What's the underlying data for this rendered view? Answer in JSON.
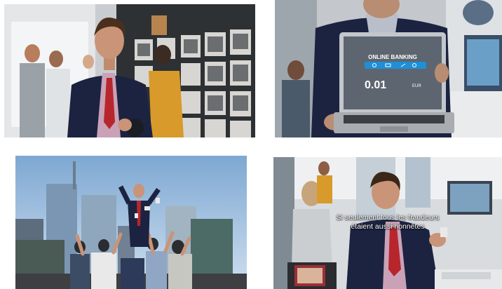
{
  "frames": [
    {
      "label": "office-scene"
    },
    {
      "label": "laptop-scene",
      "laptop": {
        "title": "ONLINE BANKING",
        "amount": "0.01",
        "currency": "EUR"
      }
    },
    {
      "label": "rooftop-scene"
    },
    {
      "label": "subtitle-scene",
      "subtitle": {
        "line1": "Si seulement tous les fraudeurs",
        "line2": "étaient aussi honnêtes"
      }
    }
  ],
  "colors": {
    "accent_blue": "#1f8fd6",
    "suit_navy": "#1c2340",
    "tie_red": "#b8262d",
    "screen_gray": "#5d6670"
  }
}
